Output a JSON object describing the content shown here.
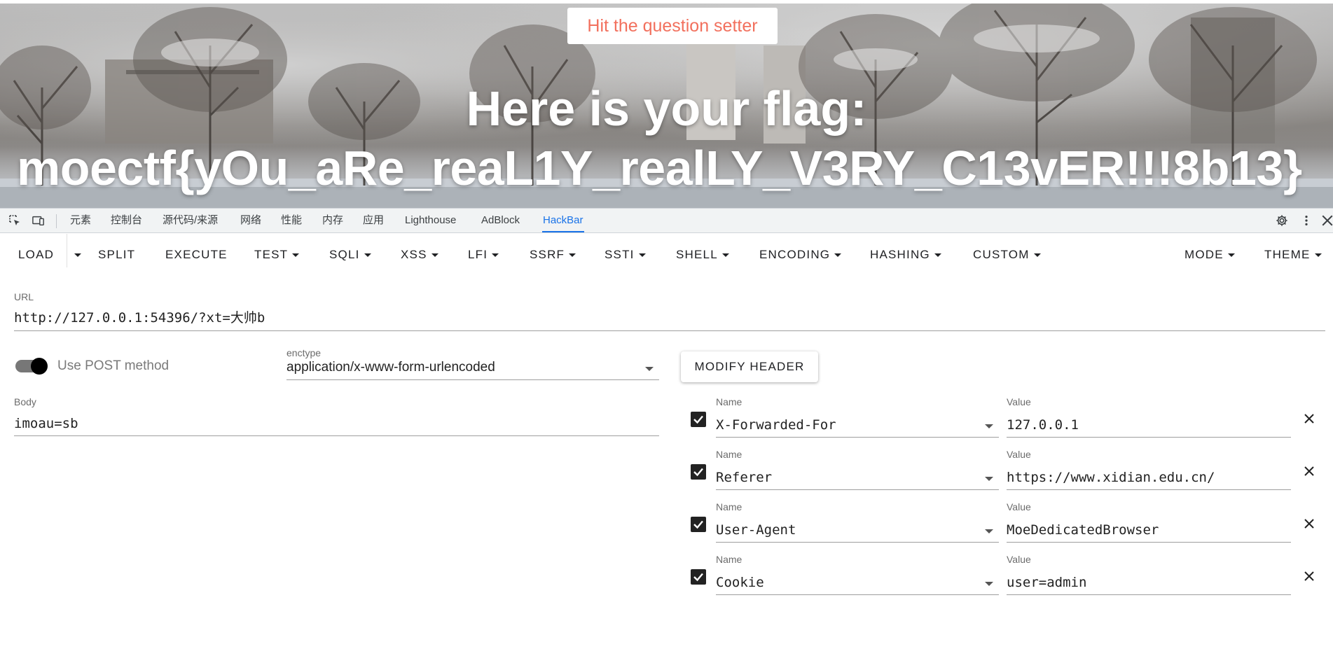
{
  "page": {
    "question_button": "Hit the question setter",
    "flag_line1": "Here is your flag:",
    "flag_line2": "moectf{yOu_aRe_reaL1Y_realLY_V3RY_C13vER!!!8b13}"
  },
  "devtools": {
    "tabs": [
      {
        "label": "元素"
      },
      {
        "label": "控制台"
      },
      {
        "label": "源代码/来源"
      },
      {
        "label": "网络"
      },
      {
        "label": "性能"
      },
      {
        "label": "内存"
      },
      {
        "label": "应用"
      },
      {
        "label": "Lighthouse"
      },
      {
        "label": "AdBlock"
      },
      {
        "label": "HackBar",
        "active": true
      }
    ]
  },
  "toolbar": {
    "load": "LOAD",
    "split": "SPLIT",
    "execute": "EXECUTE",
    "test": "TEST",
    "sqli": "SQLI",
    "xss": "XSS",
    "lfi": "LFI",
    "ssrf": "SSRF",
    "ssti": "SSTI",
    "shell": "SHELL",
    "encoding": "ENCODING",
    "hashing": "HASHING",
    "custom": "CUSTOM",
    "mode": "MODE",
    "theme": "THEME"
  },
  "url": {
    "label": "URL",
    "value": "http://127.0.0.1:54396/?xt=大帅b"
  },
  "post": {
    "toggle_label": "Use POST method",
    "enabled": true,
    "enctype_label": "enctype",
    "enctype_value": "application/x-www-form-urlencoded",
    "body_label": "Body",
    "body_value": "imoau=sb"
  },
  "headers": {
    "modify_button": "MODIFY HEADER",
    "name_label": "Name",
    "value_label": "Value",
    "rows": [
      {
        "checked": true,
        "name": "X-Forwarded-For",
        "value": "127.0.0.1"
      },
      {
        "checked": true,
        "name": "Referer",
        "value": "https://www.xidian.edu.cn/"
      },
      {
        "checked": true,
        "name": "User-Agent",
        "value": "MoeDedicatedBrowser"
      },
      {
        "checked": true,
        "name": "Cookie",
        "value": "user=admin"
      }
    ]
  }
}
